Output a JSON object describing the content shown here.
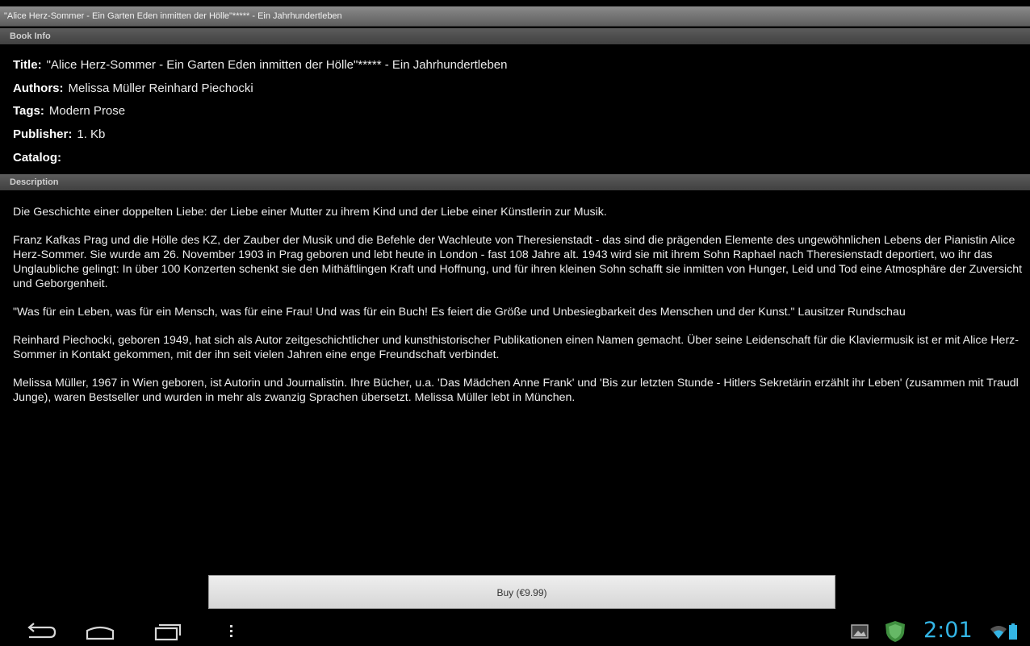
{
  "window": {
    "title": "\"Alice Herz-Sommer - Ein Garten Eden inmitten der Hölle\"***** - Ein Jahrhundertleben"
  },
  "book_info": {
    "header": "Book Info",
    "title_label": "Title:",
    "title_value": "\"Alice Herz-Sommer - Ein Garten Eden inmitten der Hölle\"***** - Ein Jahrhundertleben",
    "authors_label": "Authors:",
    "authors_value": "Melissa Müller Reinhard Piechocki",
    "tags_label": "Tags:",
    "tags_value": "Modern Prose",
    "publisher_label": "Publisher:",
    "publisher_value": "1. Kb",
    "catalog_label": "Catalog:",
    "catalog_value": ""
  },
  "description": {
    "header": "Description",
    "paragraphs": [
      "Die Geschichte einer doppelten Liebe: der Liebe einer Mutter zu ihrem Kind und der Liebe einer Künstlerin zur Musik.",
      "Franz Kafkas Prag und die Hölle des KZ, der Zauber der Musik und die Befehle der Wachleute von Theresienstadt - das sind die prägenden Elemente des ungewöhnlichen Lebens der Pianistin Alice Herz-Sommer. Sie wurde am 26. November 1903 in Prag geboren und lebt heute in London - fast 108 Jahre alt. 1943 wird sie mit ihrem Sohn Raphael nach Theresienstadt deportiert, wo ihr das Unglaubliche gelingt: In über 100 Konzerten schenkt sie den Mithäftlingen Kraft und Hoffnung, und für ihren kleinen Sohn schafft sie inmitten von Hunger, Leid und Tod eine Atmosphäre der Zuversicht und Geborgenheit.",
      "\"Was für ein Leben, was für ein Mensch, was für eine Frau! Und was für ein Buch! Es feiert die Größe und Unbesiegbarkeit des Menschen und der Kunst.\" Lausitzer Rundschau",
      "Reinhard Piechocki, geboren 1949, hat sich als Autor zeitgeschichtlicher und kunsthistorischer Publikationen einen Namen gemacht. Über seine Leidenschaft für die Klaviermusik ist er mit Alice Herz-Sommer in Kontakt gekommen, mit der ihn seit vielen Jahren eine enge Freundschaft verbindet.",
      "Melissa Müller, 1967 in Wien geboren, ist Autorin und Journalistin. Ihre Bücher, u.a. 'Das Mädchen Anne Frank' und 'Bis zur letzten Stunde - Hitlers Sekretärin erzählt ihr Leben' (zusammen mit Traudl Junge), waren Bestseller und wurden in mehr als zwanzig Sprachen übersetzt. Melissa Müller lebt in München."
    ]
  },
  "buy_button": {
    "label": "Buy (€9.99)"
  },
  "system_bar": {
    "clock": "2:01",
    "accent_color": "#33b5e5",
    "icons": [
      "back-icon",
      "home-icon",
      "recent-apps-icon",
      "menu-icon",
      "gallery-icon",
      "shield-icon",
      "wifi-icon",
      "battery-icon"
    ]
  }
}
